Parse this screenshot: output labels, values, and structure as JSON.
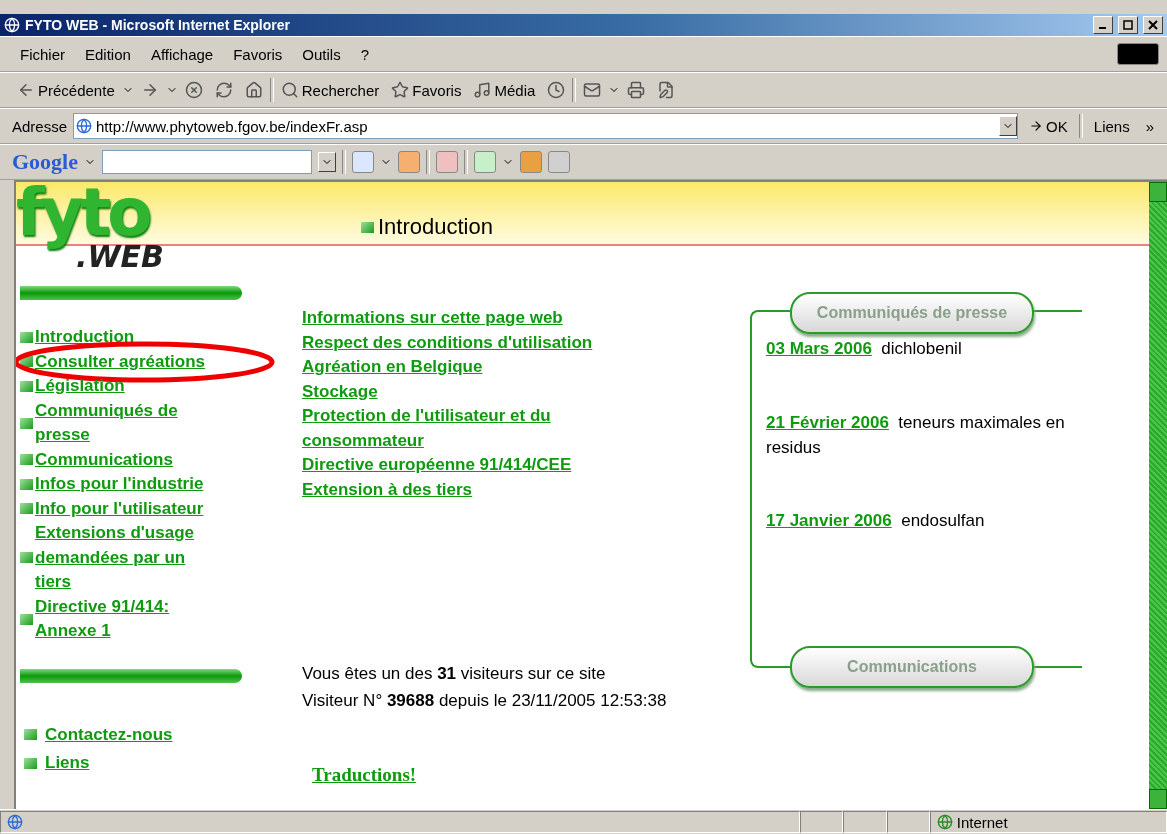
{
  "window": {
    "title": "FYTO WEB - Microsoft Internet Explorer"
  },
  "menu": [
    "Fichier",
    "Edition",
    "Affichage",
    "Favoris",
    "Outils",
    "?"
  ],
  "toolbar": [
    {
      "kind": "back",
      "label": "Précédente",
      "menu": true
    },
    {
      "kind": "forward",
      "menu": true
    },
    {
      "kind": "stop"
    },
    {
      "kind": "refresh"
    },
    {
      "kind": "home"
    },
    {
      "kind": "search",
      "label": "Rechercher"
    },
    {
      "kind": "favorites",
      "label": "Favoris"
    },
    {
      "kind": "media",
      "label": "Média"
    },
    {
      "kind": "history"
    },
    {
      "kind": "mail",
      "menu": true
    },
    {
      "kind": "print"
    },
    {
      "kind": "edit"
    }
  ],
  "address": {
    "label": "Adresse",
    "value": "http://www.phytoweb.fgov.be/indexFr.asp",
    "go": "OK",
    "links": "Liens",
    "more": "»"
  },
  "google_bar": {
    "logo": "Google"
  },
  "page": {
    "logo": {
      "word": "fyto",
      "sub": ".WEB"
    },
    "title": "Introduction",
    "sidebar": {
      "items": [
        {
          "label": "Introduction",
          "highlighted": false
        },
        {
          "label": "Consulter agréations",
          "highlighted": true
        },
        {
          "label": "Législation",
          "highlighted": false
        },
        {
          "label": "Communiqués de presse",
          "highlighted": false
        },
        {
          "label": "Communications",
          "highlighted": false
        },
        {
          "label": "Infos pour l'industrie",
          "highlighted": false
        },
        {
          "label": "Info pour l'utilisateur",
          "highlighted": false
        },
        {
          "label": "Extensions d'usage demandées par un tiers",
          "highlighted": false
        },
        {
          "label": "Directive 91/414: Annexe 1",
          "highlighted": false
        }
      ],
      "footer_items": [
        "Contactez-nous",
        "Liens"
      ]
    },
    "links": [
      "Informations sur cette page web",
      "Respect des conditions d'utilisation",
      "Agréation en Belgique",
      "Stockage",
      "Protection de l'utilisateur et du consommateur",
      "Directive européenne 91/414/CEE",
      "Extension à des tiers"
    ],
    "visitors": [
      "Vous êtes un des **31** visiteurs sur ce site",
      "Visiteur N° **39688** depuis le 23/11/2005 12:53:38"
    ],
    "translations": "Traductions!",
    "press": {
      "title": "Communiqués de presse",
      "items": [
        {
          "date": "03 Mars 2006",
          "text": "dichlobenil"
        },
        {
          "date": "21 Février 2006",
          "text": "teneurs maximales en residus"
        },
        {
          "date": "17 Janvier 2006",
          "text": "endosulfan"
        }
      ],
      "next_title": "Communications"
    }
  },
  "status_bar": {
    "zone": "Internet"
  }
}
